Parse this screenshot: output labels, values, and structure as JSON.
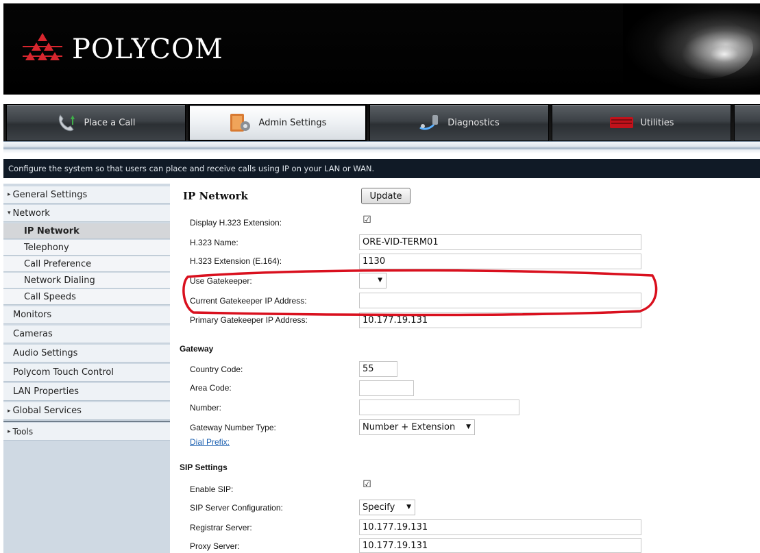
{
  "brand": {
    "name": "POLYCOM"
  },
  "nav": {
    "tabs": [
      {
        "label": "Place a Call",
        "icon": "phone-icon"
      },
      {
        "label": "Admin Settings",
        "icon": "admin-settings-icon"
      },
      {
        "label": "Diagnostics",
        "icon": "diagnostics-icon"
      },
      {
        "label": "Utilities",
        "icon": "utilities-icon"
      }
    ],
    "active": "Admin Settings"
  },
  "info_bar": "Configure the system so that users can place and receive calls using IP on your LAN or WAN.",
  "sidebar": {
    "items": [
      {
        "label": "General Settings",
        "expander": "▸"
      },
      {
        "label": "Network",
        "expander": "▾"
      },
      {
        "label": "IP Network"
      },
      {
        "label": "Telephony"
      },
      {
        "label": "Call Preference"
      },
      {
        "label": "Network Dialing"
      },
      {
        "label": "Call Speeds"
      },
      {
        "label": "Monitors"
      },
      {
        "label": "Cameras"
      },
      {
        "label": "Audio Settings"
      },
      {
        "label": "Polycom Touch Control"
      },
      {
        "label": "LAN Properties"
      },
      {
        "label": "Global Services",
        "expander": "▸"
      },
      {
        "label": "Tools",
        "expander": "▸"
      }
    ]
  },
  "main": {
    "title": "IP Network",
    "update_label": "Update",
    "h323": {
      "display_ext_label": "Display H.323 Extension:",
      "display_ext_checked": "☑",
      "name_label": "H.323 Name:",
      "name_value": "ORE-VID-TERM01",
      "ext_label": "H.323 Extension (E.164):",
      "ext_value": "1130",
      "use_gk_label": "Use Gatekeeper:",
      "use_gk_value": "",
      "current_gk_label": "Current Gatekeeper IP Address:",
      "current_gk_value": "",
      "primary_gk_label": "Primary Gatekeeper IP Address:",
      "primary_gk_value": "10.177.19.131"
    },
    "gateway": {
      "section": "Gateway",
      "country_label": "Country Code:",
      "country_value": "55",
      "area_label": "Area Code:",
      "area_value": "",
      "number_label": "Number:",
      "number_value": "",
      "type_label": "Gateway Number Type:",
      "type_value": "Number + Extension",
      "dial_prefix_link": "Dial Prefix:"
    },
    "sip": {
      "section": "SIP Settings",
      "enable_label": "Enable SIP:",
      "enable_checked": "☑",
      "server_config_label": "SIP Server Configuration:",
      "server_config_value": "Specify",
      "registrar_label": "Registrar Server:",
      "registrar_value": "10.177.19.131",
      "proxy_label": "Proxy Server:",
      "proxy_value": "10.177.19.131"
    }
  },
  "colors": {
    "header_bg": "#000000",
    "info_bar_bg": "#101a26",
    "sidebar_bg": "#eef2f6",
    "link": "#1a5fb0",
    "highlight_oval": "#d9101e"
  }
}
